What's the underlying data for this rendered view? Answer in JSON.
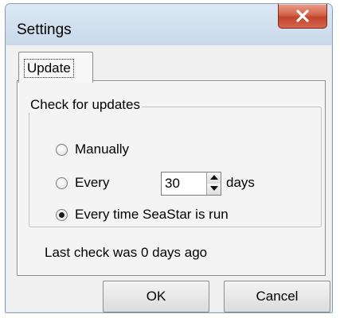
{
  "window": {
    "title": "Settings",
    "close_icon": "close-icon"
  },
  "tabs": [
    {
      "label": "Update",
      "selected": true
    }
  ],
  "update_check": {
    "group_label": "Check for updates",
    "options": [
      {
        "label": "Manually",
        "selected": false
      },
      {
        "label": "Every",
        "selected": false,
        "interval_value": "30",
        "interval_unit": "days"
      },
      {
        "label": "Every time SeaStar is run",
        "selected": true
      }
    ]
  },
  "status": {
    "last_check_text": "Last check was 0 days ago"
  },
  "buttons": {
    "ok_label": "OK",
    "cancel_label": "Cancel"
  },
  "colors": {
    "close_button": "#c94b34",
    "titlebar": "#d3e1ef"
  }
}
